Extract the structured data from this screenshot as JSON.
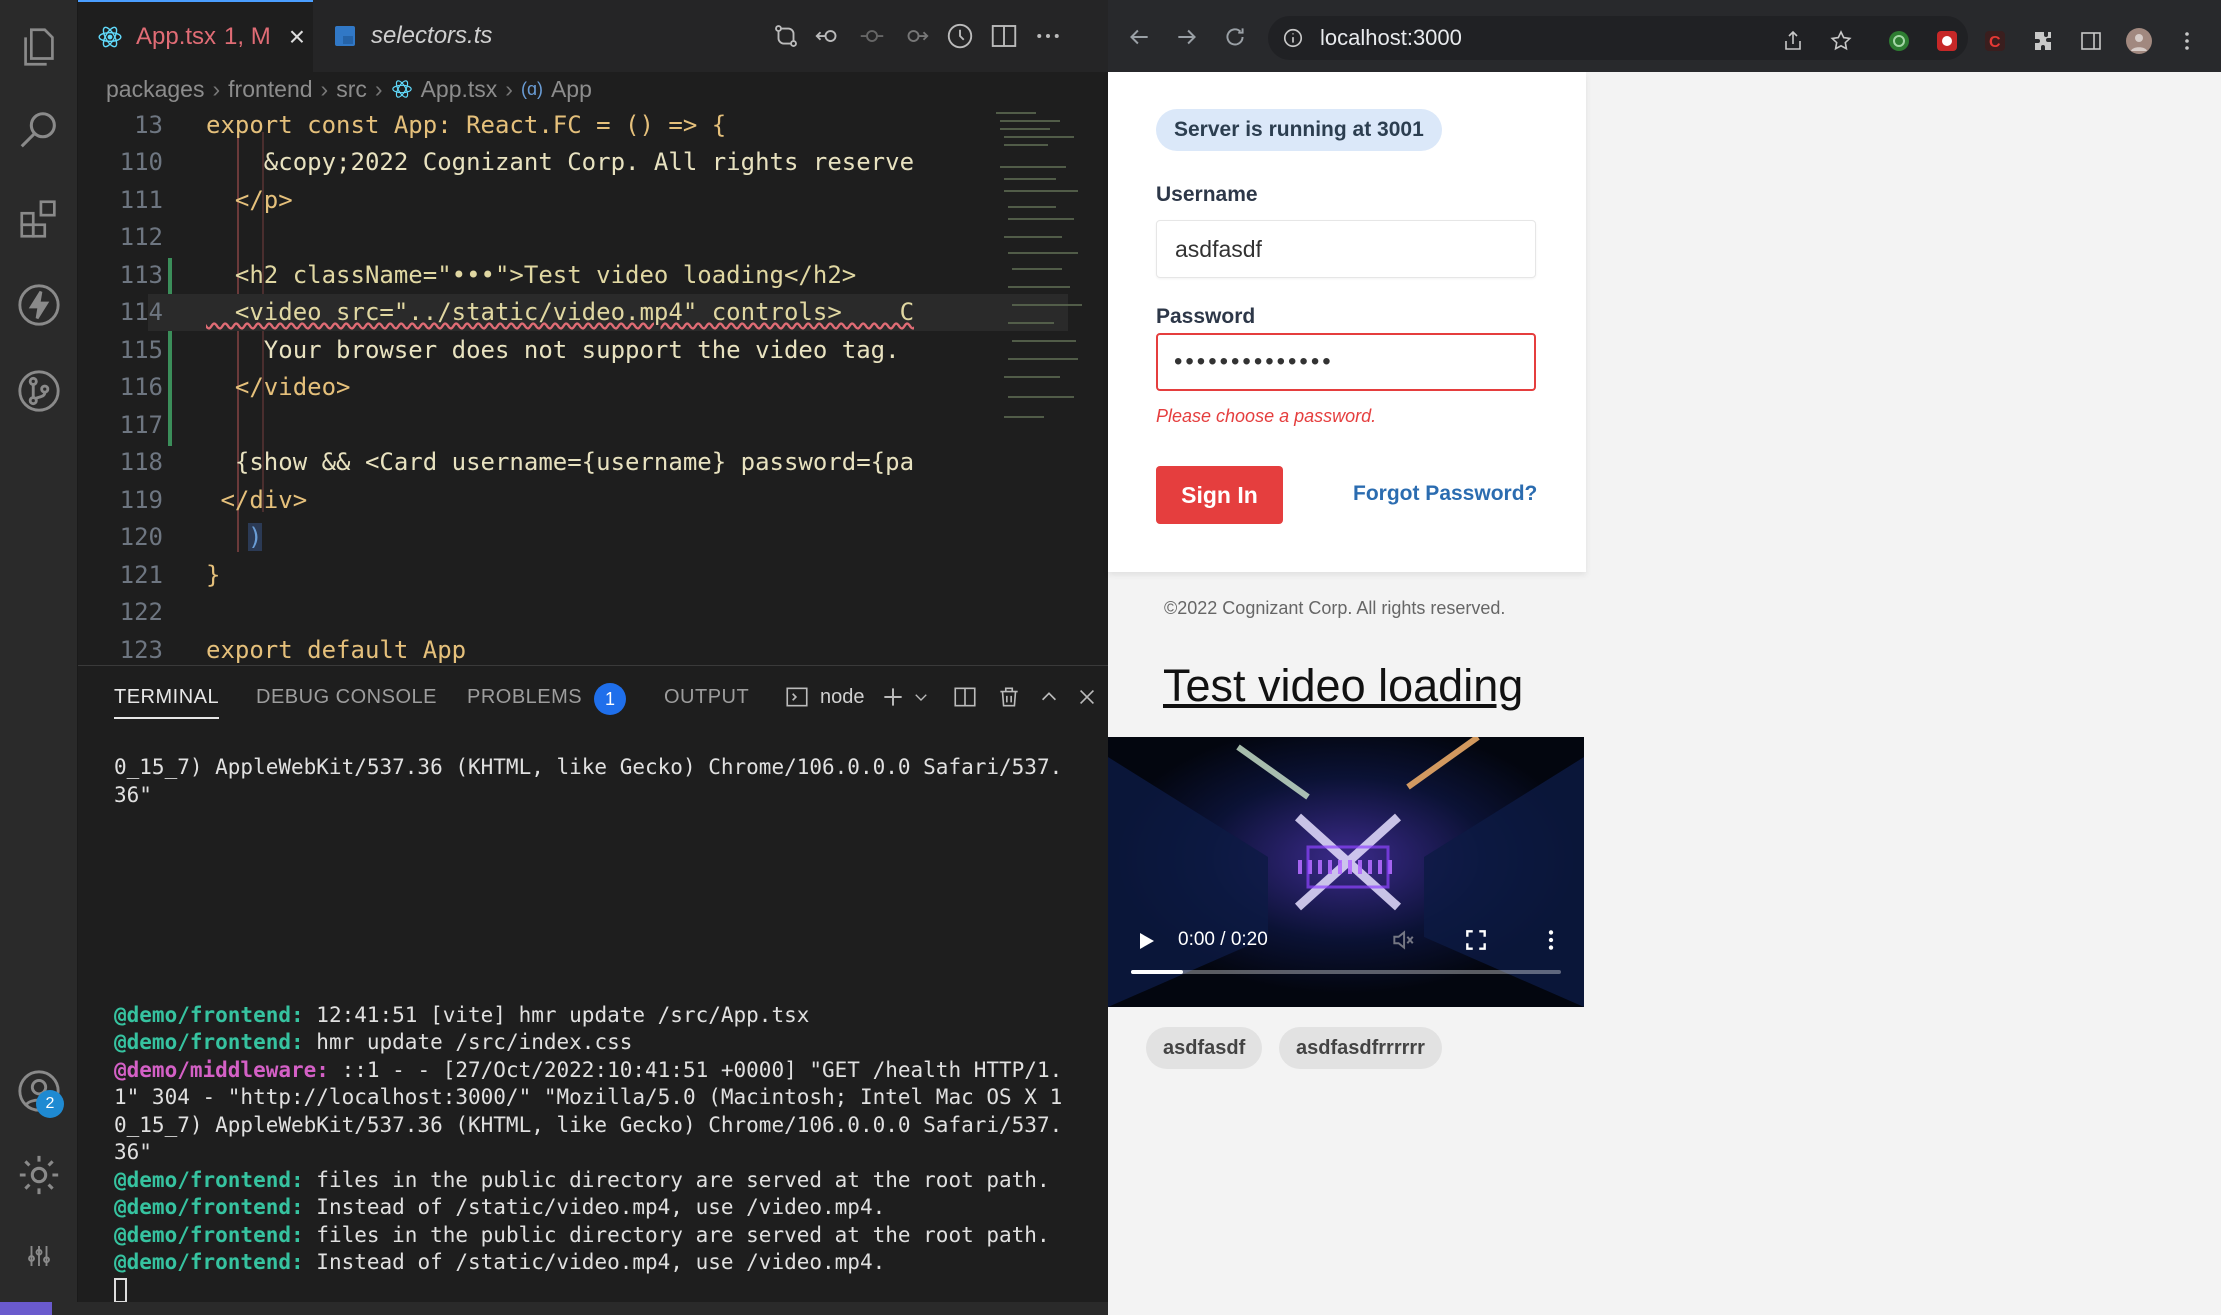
{
  "editor": {
    "tabs": [
      {
        "label": "App.tsx",
        "status": "1, M"
      },
      {
        "label": "selectors.ts"
      }
    ],
    "breadcrumb": [
      "packages",
      "frontend",
      "src",
      "App.tsx",
      "App"
    ],
    "lines": [
      {
        "num": "13",
        "code": "export const App: React.FC = () => {"
      },
      {
        "num": "110",
        "code": "    &copy;2022 Cognizant Corp. All rights reserve"
      },
      {
        "num": "111",
        "code": "  </p>"
      },
      {
        "num": "112",
        "code": ""
      },
      {
        "num": "113",
        "code": "  <h2 className=\"•••\">Test video loading</h2>"
      },
      {
        "num": "114",
        "code": "  <video src=\"../static/video.mp4\" controls>    C"
      },
      {
        "num": "115",
        "code": "    Your browser does not support the video tag."
      },
      {
        "num": "116",
        "code": "  </video>"
      },
      {
        "num": "117",
        "code": ""
      },
      {
        "num": "118",
        "code": "  {show && <Card username={username} password={pa"
      },
      {
        "num": "119",
        "code": " </div>"
      },
      {
        "num": "120",
        "code": ")"
      },
      {
        "num": "121",
        "code": "}"
      },
      {
        "num": "122",
        "code": ""
      },
      {
        "num": "123",
        "code": "export default App"
      }
    ]
  },
  "panel": {
    "tabs": [
      "TERMINAL",
      "DEBUG CONSOLE",
      "PROBLEMS",
      "OUTPUT"
    ],
    "problems_count": "1",
    "terminal_name": "node",
    "terminal_lines": [
      {
        "prefix": "",
        "text": "0_15_7) AppleWebKit/537.36 (KHTML, like Gecko) Chrome/106.0.0.0 Safari/537."
      },
      {
        "prefix": "",
        "text": "36\""
      },
      {
        "prefix": "",
        "text": ""
      },
      {
        "prefix": "",
        "text": ""
      },
      {
        "prefix": "",
        "text": ""
      },
      {
        "prefix": "",
        "text": ""
      },
      {
        "prefix": "",
        "text": ""
      },
      {
        "prefix": "",
        "text": ""
      },
      {
        "prefix": "",
        "text": ""
      },
      {
        "prefix": "@demo/frontend:",
        "kind": "front",
        "text": " 12:41:51 [vite] hmr update /src/App.tsx"
      },
      {
        "prefix": "@demo/frontend:",
        "kind": "front",
        "text": " hmr update /src/index.css"
      },
      {
        "prefix": "@demo/middleware:",
        "kind": "mid",
        "text": " ::1 - - [27/Oct/2022:10:41:51 +0000] \"GET /health HTTP/1."
      },
      {
        "prefix": "",
        "text": "1\" 304 - \"http://localhost:3000/\" \"Mozilla/5.0 (Macintosh; Intel Mac OS X 1"
      },
      {
        "prefix": "",
        "text": "0_15_7) AppleWebKit/537.36 (KHTML, like Gecko) Chrome/106.0.0.0 Safari/537."
      },
      {
        "prefix": "",
        "text": "36\""
      },
      {
        "prefix": "@demo/frontend:",
        "kind": "front",
        "text": " files in the public directory are served at the root path."
      },
      {
        "prefix": "@demo/frontend:",
        "kind": "front",
        "text": " Instead of /static/video.mp4, use /video.mp4."
      },
      {
        "prefix": "@demo/frontend:",
        "kind": "front",
        "text": " files in the public directory are served at the root path."
      },
      {
        "prefix": "@demo/frontend:",
        "kind": "front",
        "text": " Instead of /static/video.mp4, use /video.mp4."
      }
    ]
  },
  "activity_bar": {
    "icons": [
      "files-icon",
      "search-icon",
      "extensions-icon",
      "lightning-icon",
      "source-control-icon"
    ],
    "accounts_badge": "2"
  },
  "browser": {
    "url": "localhost:3000",
    "page": {
      "server_status": "Server is running at 3001",
      "username_label": "Username",
      "username_value": "asdfasdf",
      "password_label": "Password",
      "password_value": "••••••••••••••",
      "password_error": "Please choose a password.",
      "signin_label": "Sign In",
      "forgot_label": "Forgot Password?",
      "copyright": "©2022 Cognizant Corp. All rights reserved.",
      "heading": "Test video loading",
      "video_time": "0:00 / 0:20",
      "video_progress": 0.12,
      "chips": [
        "asdfasdf",
        "asdfasdfrrrrrr"
      ]
    }
  },
  "colors": {
    "accent_red": "#e53e3e",
    "link_blue": "#2b6cb0",
    "badge_blue": "#1f6feb"
  }
}
